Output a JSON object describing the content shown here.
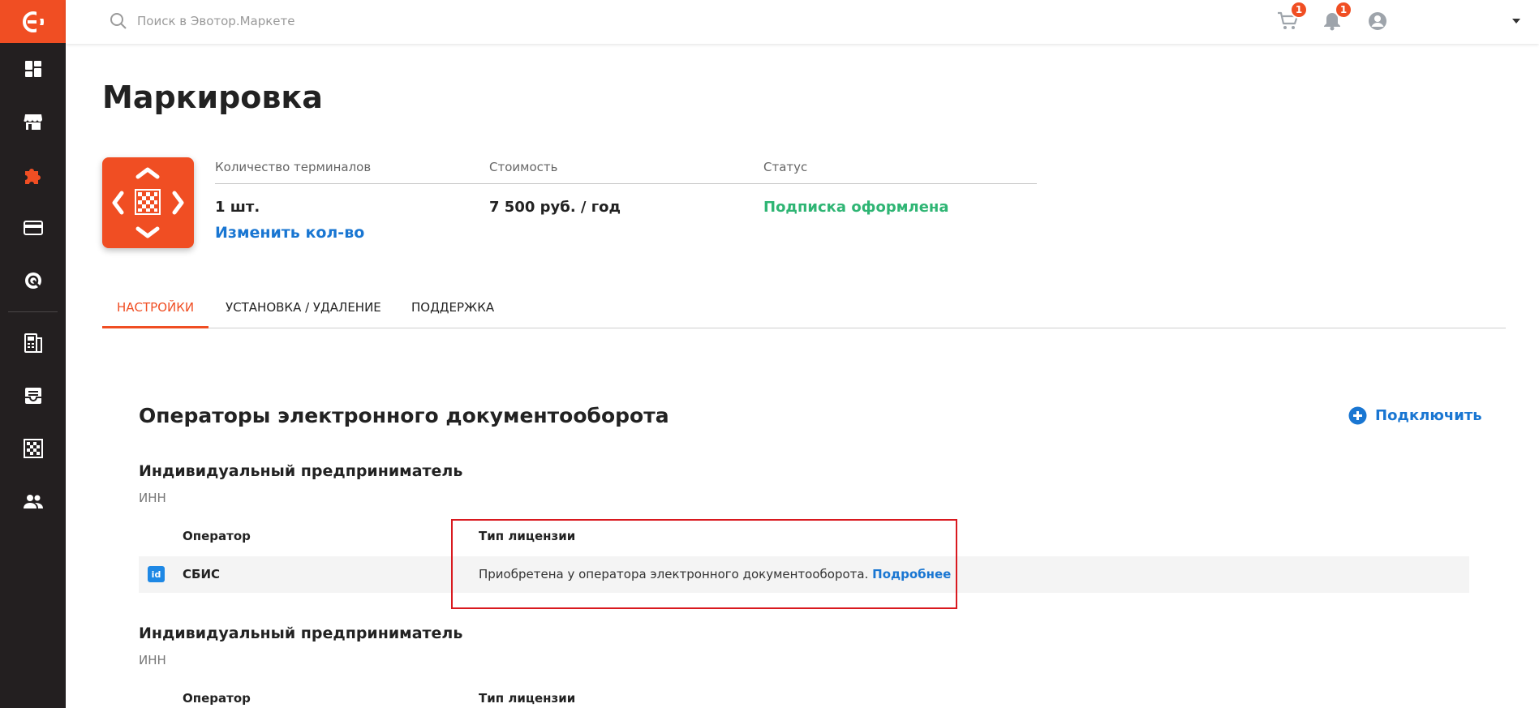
{
  "app": {
    "accent": "#f04e23",
    "sidebar_bg": "#231f20",
    "logo_icon": "evotor-logo-icon"
  },
  "sidebar": {
    "items": [
      {
        "icon": "dashboard-icon",
        "active": false
      },
      {
        "icon": "store-icon",
        "active": false
      },
      {
        "icon": "puzzle-icon",
        "active": true
      },
      {
        "icon": "card-icon",
        "active": false
      },
      {
        "icon": "loyalty-icon",
        "active": false
      },
      {
        "icon": "terminal-icon",
        "active": false
      },
      {
        "icon": "inbox-icon",
        "active": false
      },
      {
        "icon": "marking-icon",
        "active": false
      },
      {
        "icon": "users-icon",
        "active": false
      }
    ]
  },
  "header": {
    "search_placeholder": "Поиск в Эвотор.Маркете",
    "cart_count": "1",
    "notifications_count": "1"
  },
  "page": {
    "title": "Маркировка",
    "summary": {
      "terminals_label": "Количество терминалов",
      "terminals_value": "1 шт.",
      "change_link": "Изменить кол-во",
      "price_label": "Стоимость",
      "price_value": "7 500 руб. / год",
      "status_label": "Статус",
      "status_value": "Подписка оформлена",
      "status_color": "#2fb574"
    },
    "tabs": [
      {
        "label": "НАСТРОЙКИ",
        "active": true
      },
      {
        "label": "УСТАНОВКА / УДАЛЕНИЕ",
        "active": false
      },
      {
        "label": "ПОДДЕРЖКА",
        "active": false
      }
    ]
  },
  "edo": {
    "title": "Операторы электронного документооборота",
    "connect_label": "Подключить",
    "entities": [
      {
        "title": "Индивидуальный предприниматель",
        "inn_label": "ИНН",
        "operator_col": "Оператор",
        "license_col": "Тип лицензии",
        "row": {
          "badge": "id",
          "operator": "СБИС",
          "license_text": "Приобретена у оператора электронного документооборота.",
          "more_link": "Подробнее"
        }
      },
      {
        "title": "Индивидуальный предприниматель",
        "inn_label": "ИНН",
        "operator_col": "Оператор",
        "license_col": "Тип лицензии"
      }
    ]
  }
}
